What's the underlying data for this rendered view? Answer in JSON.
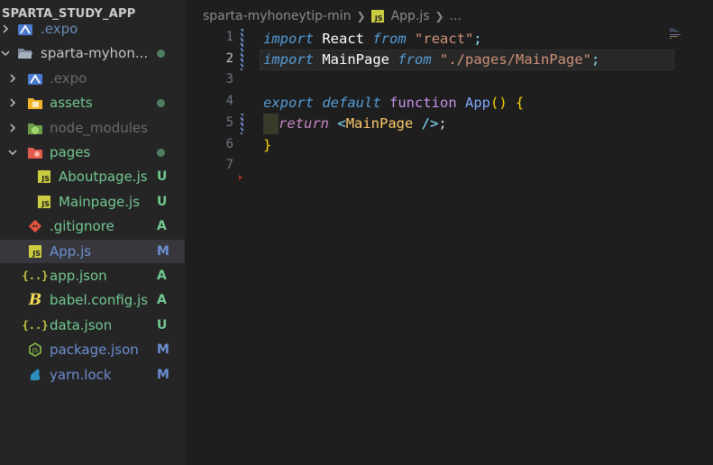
{
  "sidebar": {
    "title": "SPARTA_STUDY_APP",
    "items": [
      {
        "label": ".expo",
        "icon": "expo-folder-icon",
        "chevron": "right",
        "indent": 0,
        "status": "",
        "dot": false,
        "color": "#6a8bb5"
      },
      {
        "label": "sparta-myhon...",
        "icon": "folder-open-icon",
        "chevron": "down",
        "indent": 0,
        "status": "",
        "dot": true,
        "color": "#c5c5c5"
      },
      {
        "label": ".expo",
        "icon": "expo-folder-icon",
        "chevron": "right",
        "indent": 1,
        "status": "",
        "dot": false,
        "color": "#6a6a6a"
      },
      {
        "label": "assets",
        "icon": "assets-folder-icon",
        "chevron": "right",
        "indent": 1,
        "status": "",
        "dot": true,
        "color": "#73c991"
      },
      {
        "label": "node_modules",
        "icon": "node-folder-icon",
        "chevron": "right",
        "indent": 1,
        "status": "",
        "dot": false,
        "color": "#6a6a6a"
      },
      {
        "label": "pages",
        "icon": "pages-folder-icon",
        "chevron": "down",
        "indent": 1,
        "status": "",
        "dot": true,
        "color": "#73c991"
      },
      {
        "label": "Aboutpage.js",
        "icon": "js-file-icon",
        "chevron": "",
        "indent": 2,
        "status": "U",
        "dot": false,
        "color": "#73c991"
      },
      {
        "label": "Mainpage.js",
        "icon": "js-file-icon",
        "chevron": "",
        "indent": 2,
        "status": "U",
        "dot": false,
        "color": "#73c991"
      },
      {
        "label": ".gitignore",
        "icon": "git-icon",
        "chevron": "",
        "indent": 1,
        "status": "A",
        "dot": false,
        "color": "#73c991"
      },
      {
        "label": "App.js",
        "icon": "js-file-icon",
        "chevron": "",
        "indent": 1,
        "status": "M",
        "dot": false,
        "color": "#6c8fd1",
        "selected": true
      },
      {
        "label": "app.json",
        "icon": "json-icon",
        "chevron": "",
        "indent": 1,
        "status": "A",
        "dot": false,
        "color": "#73c991"
      },
      {
        "label": "babel.config.js",
        "icon": "babel-icon",
        "chevron": "",
        "indent": 1,
        "status": "A",
        "dot": false,
        "color": "#73c991"
      },
      {
        "label": "data.json",
        "icon": "json-icon",
        "chevron": "",
        "indent": 1,
        "status": "U",
        "dot": false,
        "color": "#73c991"
      },
      {
        "label": "package.json",
        "icon": "nodejs-icon",
        "chevron": "",
        "indent": 1,
        "status": "M",
        "dot": false,
        "color": "#6c8fd1"
      },
      {
        "label": "yarn.lock",
        "icon": "yarn-icon",
        "chevron": "",
        "indent": 1,
        "status": "M",
        "dot": false,
        "color": "#6c8fd1"
      }
    ]
  },
  "breadcrumb": {
    "folder": "sparta-myhoneytip-min",
    "file_icon": "JS",
    "file": "App.js",
    "more": "..."
  },
  "editor": {
    "line_numbers": [
      "1",
      "2",
      "3",
      "4",
      "5",
      "6",
      "7"
    ],
    "active_line": 2,
    "lines": {
      "l1": {
        "kw": "import",
        "name": "React",
        "from": "from",
        "str": "\"react\"",
        "semi": ";"
      },
      "l2": {
        "kw": "import",
        "name": "MainPage",
        "from": "from",
        "str": "\"./pages/MainPage\"",
        "semi": ";"
      },
      "l4": {
        "export": "export",
        "default": "default",
        "function": "function",
        "fname": "App",
        "parens": "()",
        "brace": "{"
      },
      "l5": {
        "ret": "return",
        "open": "<",
        "tag": "MainPage",
        "close": " />",
        "semi": ";"
      },
      "l6": {
        "brace": "}"
      }
    }
  },
  "colors": {
    "git_added": "#73c991",
    "git_modified": "#6c8fd1",
    "selection": "#37373d"
  }
}
